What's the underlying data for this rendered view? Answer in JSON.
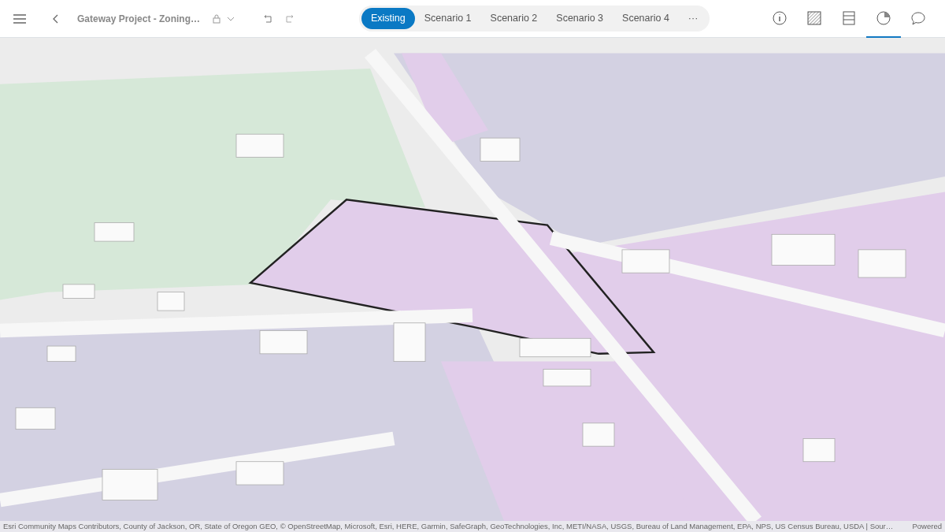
{
  "header": {
    "title": "Gateway Project - Zoning…"
  },
  "scenarios": [
    {
      "label": "Existing",
      "selected": true
    },
    {
      "label": "Scenario 1",
      "selected": false
    },
    {
      "label": "Scenario 2",
      "selected": false
    },
    {
      "label": "Scenario 3",
      "selected": false
    },
    {
      "label": "Scenario 4",
      "selected": false
    }
  ],
  "more": "···",
  "tools": [
    {
      "kind": "info",
      "selected": false
    },
    {
      "kind": "zones",
      "selected": false
    },
    {
      "kind": "table",
      "selected": false
    },
    {
      "kind": "chart",
      "selected": true
    },
    {
      "kind": "comment",
      "selected": false
    }
  ],
  "attribution": {
    "text": "Esri Community Maps Contributors, County of Jackson, OR, State of Oregon GEO, © OpenStreetMap, Microsoft, Esri, HERE, Garmin, SafeGraph, GeoTechnologies, Inc, METI/NASA, USGS, Bureau of Land Management, EPA, NPS, US Census Bureau, USDA | Sour…",
    "powered": "Powered"
  }
}
